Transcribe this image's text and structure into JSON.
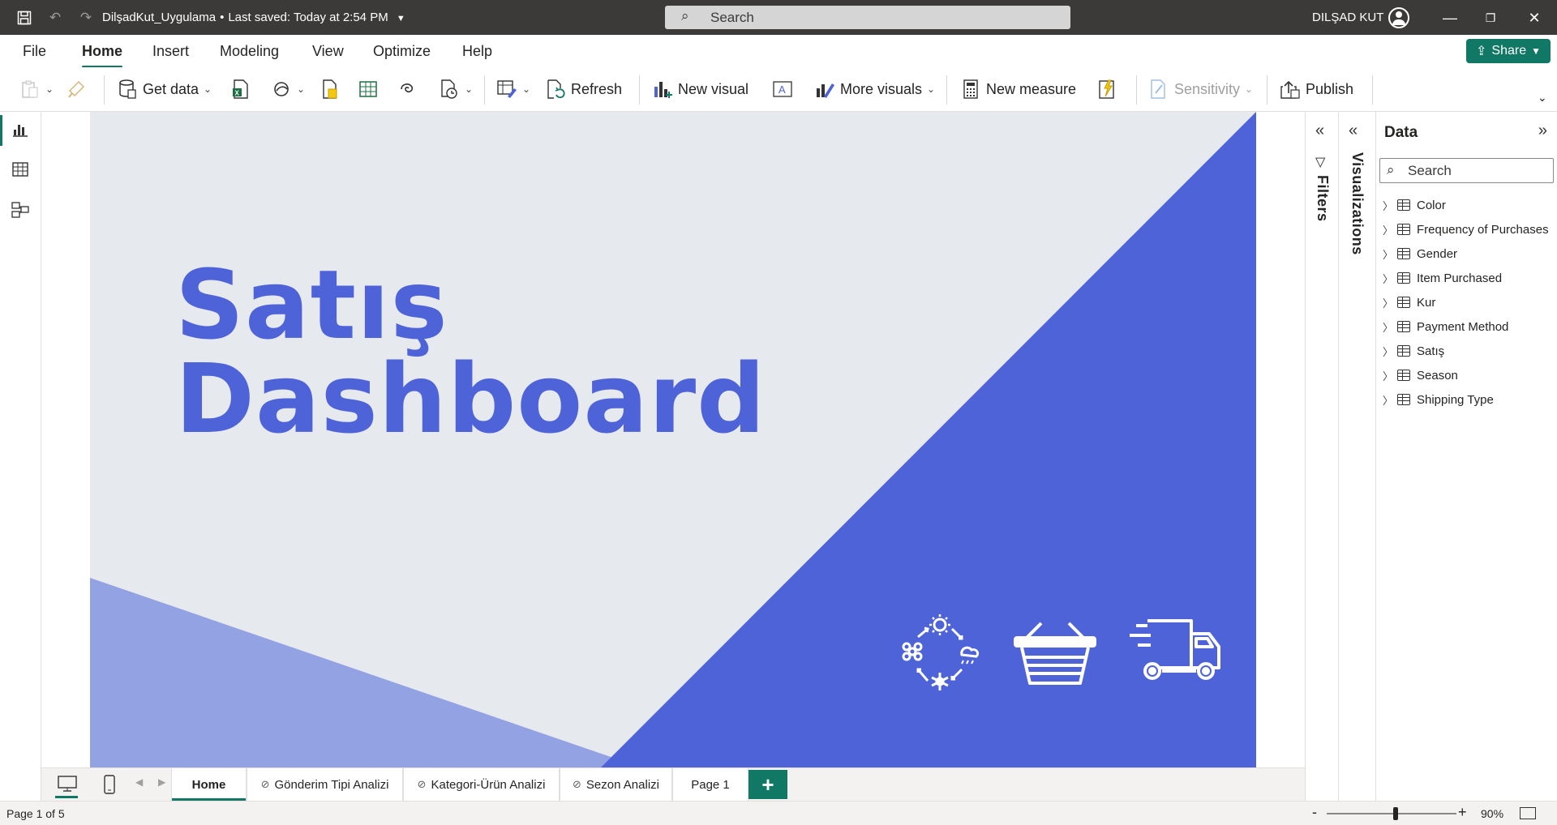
{
  "titlebar": {
    "file_name": "DilşadKut_Uygulama",
    "saved_status": "Last saved: Today at 2:54 PM",
    "search_placeholder": "Search",
    "user_name": "DILŞAD KUT"
  },
  "menu": {
    "tabs": [
      "File",
      "Home",
      "Insert",
      "Modeling",
      "View",
      "Optimize",
      "Help"
    ],
    "active": "Home",
    "share_label": "Share"
  },
  "ribbon": {
    "get_data": "Get data",
    "refresh": "Refresh",
    "new_visual": "New visual",
    "more_visuals": "More visuals",
    "new_measure": "New measure",
    "sensitivity": "Sensitivity",
    "publish": "Publish"
  },
  "report": {
    "title_line1": "Satış",
    "title_line2": "Dashboard",
    "colors": {
      "background": "#e6e9ed",
      "primary": "#4f63d9",
      "secondary": "#93a2e3"
    },
    "icons": [
      "seasons-cycle-icon",
      "shopping-basket-icon",
      "delivery-truck-icon"
    ]
  },
  "panes": {
    "filters_label": "Filters",
    "visualizations_label": "Visualizations",
    "data_title": "Data",
    "data_search_placeholder": "Search",
    "fields": [
      "Color",
      "Frequency of Purchases",
      "Gender",
      "Item Purchased",
      "Kur",
      "Payment Method",
      "Satış",
      "Season",
      "Shipping Type"
    ]
  },
  "pages": {
    "tabs": [
      {
        "label": "Home",
        "hidden": false,
        "active": true
      },
      {
        "label": "Gönderim Tipi Analizi",
        "hidden": true,
        "active": false
      },
      {
        "label": "Kategori-Ürün Analizi",
        "hidden": true,
        "active": false
      },
      {
        "label": "Sezon Analizi",
        "hidden": true,
        "active": false
      },
      {
        "label": "Page 1",
        "hidden": false,
        "active": false
      }
    ],
    "add_label": "+"
  },
  "status": {
    "page_indicator": "Page 1 of 5",
    "zoom_minus": "-",
    "zoom_plus": "+",
    "zoom_level": "90%"
  }
}
